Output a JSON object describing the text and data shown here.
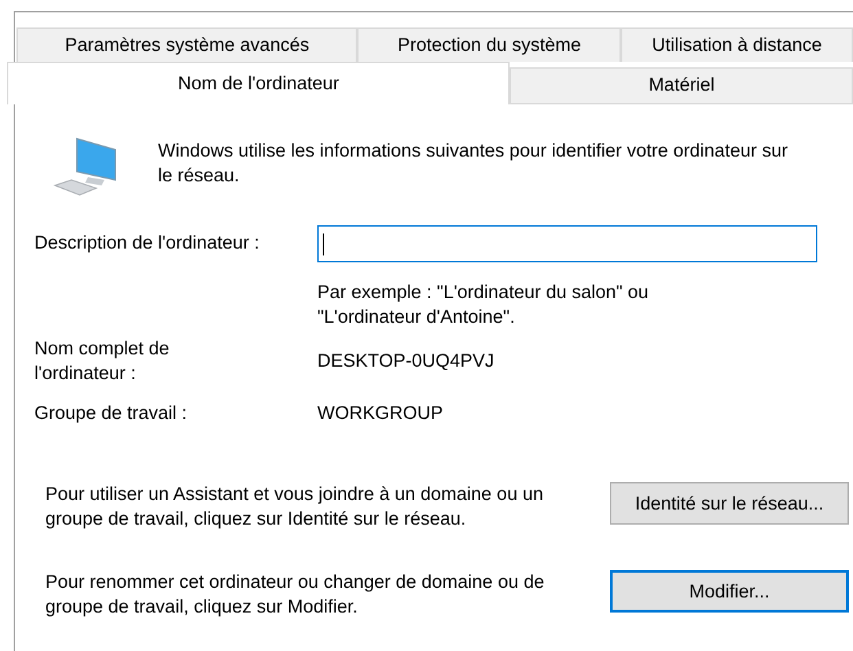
{
  "tabs": [
    [
      {
        "label": "Paramètres système avancés",
        "selected": false
      },
      {
        "label": "Protection du système",
        "selected": false
      },
      {
        "label": "Utilisation à distance",
        "selected": false
      }
    ],
    [
      {
        "label": "Nom de l'ordinateur",
        "selected": true
      },
      {
        "label": "Matériel",
        "selected": false
      }
    ]
  ],
  "intro": "Windows utilise les informations suivantes pour identifier votre ordinateur sur le réseau.",
  "description": {
    "label": "Description de l'ordinateur :",
    "focused": true,
    "hint": "Par exemple : \"L'ordinateur du salon\" ou \"L'ordinateur d'Antoine\"."
  },
  "fields": [
    {
      "label": "Nom complet de l'ordinateur :",
      "value": "DESKTOP-0UQ4PVJ"
    },
    {
      "label": "Groupe de travail :",
      "value": "WORKGROUP"
    }
  ],
  "actions": [
    {
      "text": "Pour utiliser un Assistant et vous joindre à un domaine ou un groupe de travail, cliquez sur Identité sur le réseau.",
      "button": "Identité sur le réseau...",
      "default": false
    },
    {
      "text": "Pour renommer cet ordinateur ou changer de domaine ou de groupe de travail, cliquez sur Modifier.",
      "button": "Modifier...",
      "default": true
    }
  ]
}
